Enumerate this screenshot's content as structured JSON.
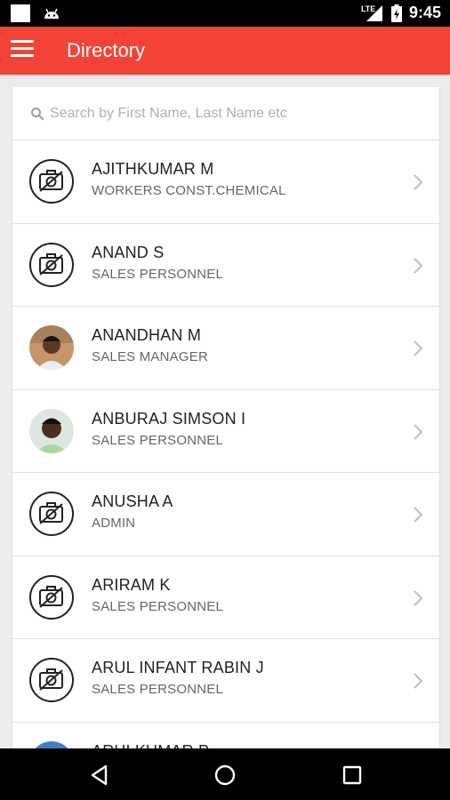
{
  "status_bar": {
    "time": "9:45",
    "network": "LTE",
    "icons": [
      "notification-square-icon",
      "android-icon",
      "signal-icon",
      "battery-icon"
    ]
  },
  "app_bar": {
    "title": "Directory",
    "menu_icon": "hamburger-menu-icon",
    "color": "#f44336"
  },
  "search": {
    "placeholder": "Search by First Name, Last Name etc",
    "value": ""
  },
  "contacts": [
    {
      "name": "AJITHKUMAR M",
      "role": "WORKERS CONST.CHEMICAL",
      "avatar": "no-photo-icon"
    },
    {
      "name": "ANAND S",
      "role": "SALES PERSONNEL",
      "avatar": "no-photo-icon"
    },
    {
      "name": "ANANDHAN M",
      "role": "SALES MANAGER",
      "avatar": "photo"
    },
    {
      "name": "ANBURAJ SIMSON I",
      "role": "SALES PERSONNEL",
      "avatar": "photo"
    },
    {
      "name": "ANUSHA A",
      "role": "ADMIN",
      "avatar": "no-photo-icon"
    },
    {
      "name": "ARIRAM K",
      "role": "SALES PERSONNEL",
      "avatar": "no-photo-icon"
    },
    {
      "name": "ARUL INFANT RABIN J",
      "role": "SALES PERSONNEL",
      "avatar": "no-photo-icon"
    },
    {
      "name": "ARULKUMAR P",
      "role": "",
      "avatar": "photo"
    }
  ],
  "nav_bar": {
    "buttons": [
      "back-icon",
      "home-icon",
      "recents-icon"
    ]
  }
}
